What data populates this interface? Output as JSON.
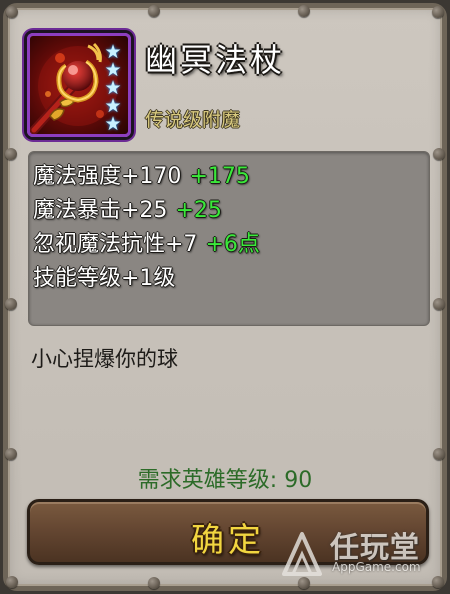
{
  "item": {
    "name": "幽冥法杖",
    "rarity": "传说级附魔",
    "star_count": 5,
    "icon": "staff-orb-icon"
  },
  "stats": [
    {
      "base": "魔法强度+170",
      "bonus": "+175"
    },
    {
      "base": "魔法暴击+25",
      "bonus": "+25"
    },
    {
      "base": "忽视魔法抗性+7",
      "bonus": "+6点"
    },
    {
      "base": "技能等级+1级",
      "bonus": ""
    }
  ],
  "flavor_text": "小心捏爆你的球",
  "requirement": {
    "label": "需求英雄等级:",
    "value": "90"
  },
  "confirm_button": {
    "label": "确定"
  },
  "watermark": {
    "name": "任玩堂",
    "url": "AppGame.com"
  },
  "colors": {
    "panel_bg": "#c7c1b9",
    "stat_bonus": "#3ae93a",
    "requirement_text": "#2c6b28",
    "button_text": "#f2d640",
    "rarity_text": "#d8c97e",
    "icon_frame": "#8d3ec0"
  }
}
